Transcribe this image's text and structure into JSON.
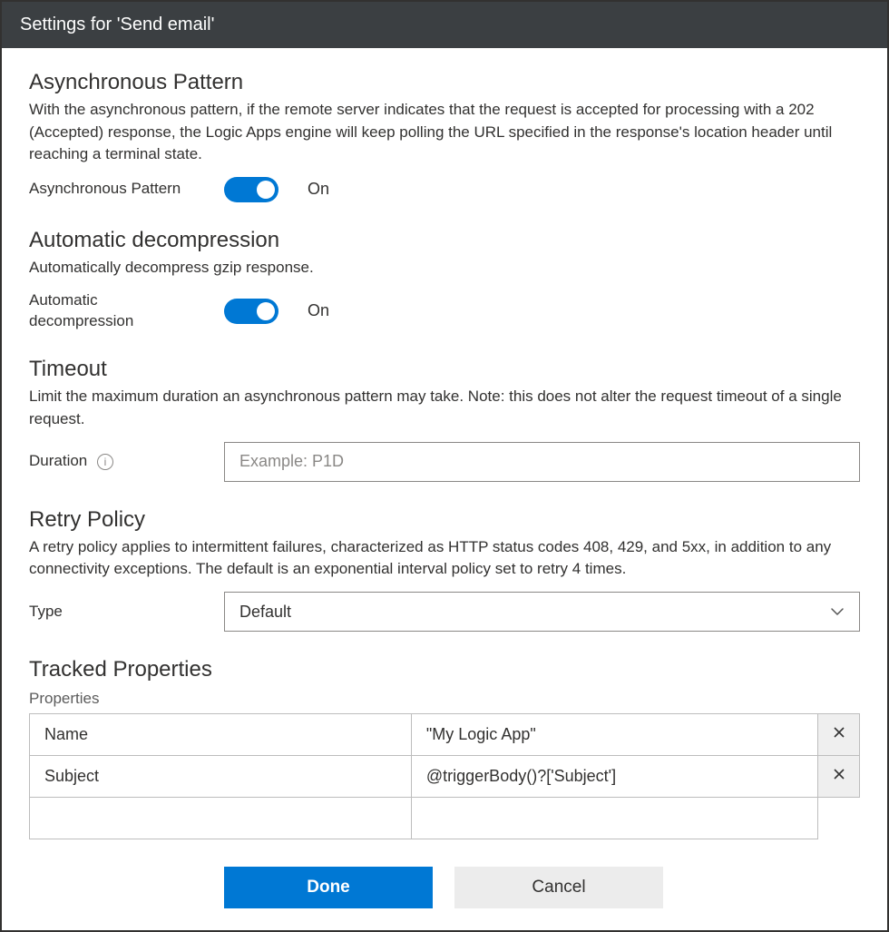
{
  "window": {
    "title": "Settings for 'Send email'"
  },
  "async": {
    "heading": "Asynchronous Pattern",
    "description": "With the asynchronous pattern, if the remote server indicates that the request is accepted for processing with a 202 (Accepted) response, the Logic Apps engine will keep polling the URL specified in the response's location header until reaching a terminal state.",
    "toggle_label": "Asynchronous Pattern",
    "toggle_state": "On"
  },
  "decomp": {
    "heading": "Automatic decompression",
    "description": "Automatically decompress gzip response.",
    "toggle_label": "Automatic decompression",
    "toggle_state": "On"
  },
  "timeout": {
    "heading": "Timeout",
    "description": "Limit the maximum duration an asynchronous pattern may take. Note: this does not alter the request timeout of a single request.",
    "duration_label": "Duration",
    "duration_placeholder": "Example: P1D"
  },
  "retry": {
    "heading": "Retry Policy",
    "description": "A retry policy applies to intermittent failures, characterized as HTTP status codes 408, 429, and 5xx, in addition to any connectivity exceptions. The default is an exponential interval policy set to retry 4 times.",
    "type_label": "Type",
    "type_value": "Default"
  },
  "tracked": {
    "heading": "Tracked Properties",
    "props_label": "Properties",
    "rows": [
      {
        "key": "Name",
        "value": "\"My Logic App\""
      },
      {
        "key": "Subject",
        "value": "@triggerBody()?['Subject']"
      },
      {
        "key": "",
        "value": ""
      }
    ]
  },
  "footer": {
    "done": "Done",
    "cancel": "Cancel"
  }
}
